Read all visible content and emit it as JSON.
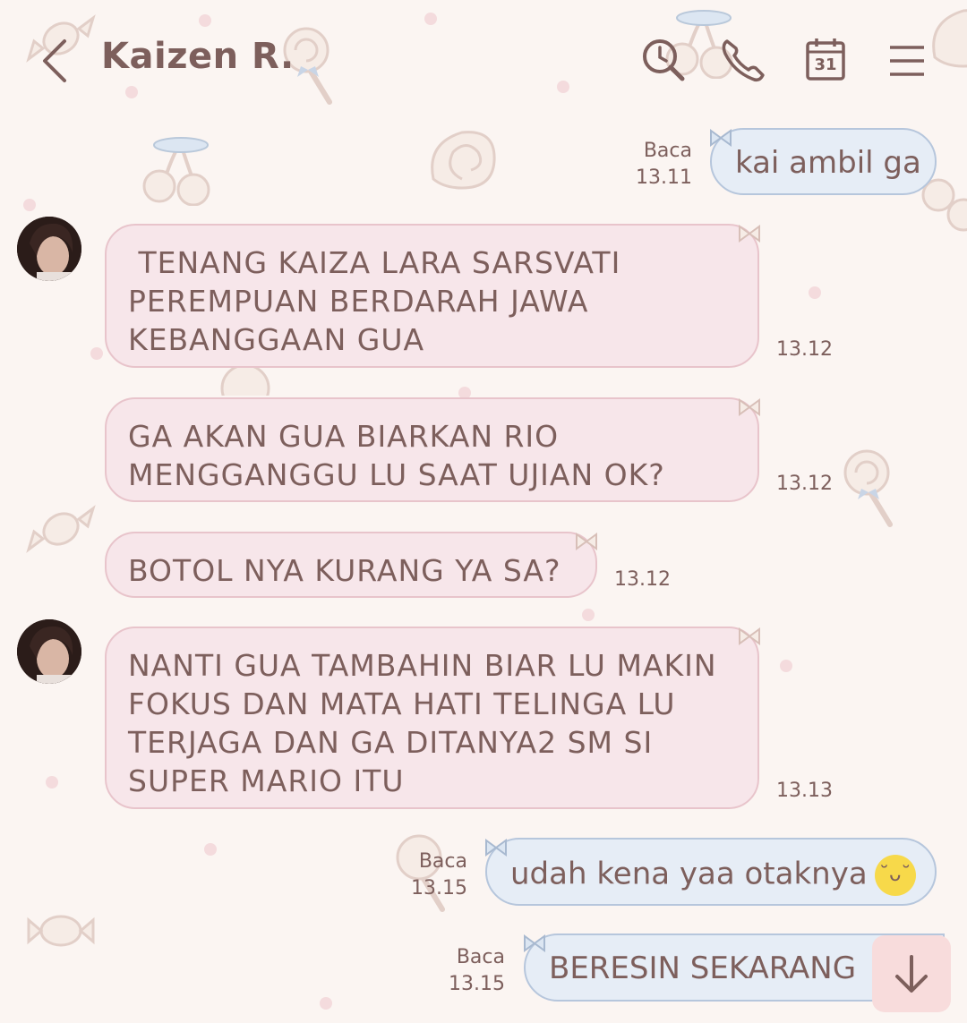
{
  "header": {
    "title": "Kaizen R.",
    "calendar_day": "31"
  },
  "messages": [
    {
      "side": "out",
      "text": "kai ambil ga",
      "read": "Baca",
      "time": "13.11"
    },
    {
      "side": "in",
      "lines": [
        " TENANG KAIZA LARA SARSVATI",
        "PEREMPUAN BERDARAH JAWA",
        "KEBANGGAAN GUA"
      ],
      "time": "13.12"
    },
    {
      "side": "in",
      "lines": [
        "GA AKAN GUA BIARKAN RIO",
        "MENGGANGGU LU SAAT UJIAN OK?"
      ],
      "time": "13.12"
    },
    {
      "side": "in",
      "lines": [
        "BOTOL NYA KURANG YA SA?"
      ],
      "time": "13.12"
    },
    {
      "side": "in",
      "lines": [
        "NANTI GUA TAMBAHIN BIAR LU MAKIN",
        "FOKUS DAN MATA HATI TELINGA LU",
        "TERJAGA DAN GA DITANYA2 SM SI",
        "SUPER MARIO ITU"
      ],
      "time": "13.13"
    },
    {
      "side": "out",
      "text": "udah kena yaa otaknya",
      "read": "Baca",
      "time": "13.15"
    },
    {
      "side": "out",
      "text": "BERESIN SEKARANG",
      "read": "Baca",
      "time": "13.15"
    }
  ],
  "icons": [
    "back-icon",
    "search-clock-icon",
    "phone-icon",
    "calendar-icon",
    "menu-icon",
    "arrow-down-icon"
  ],
  "colors": {
    "background": "#fbf5f2",
    "incoming": "#f7e6ea",
    "outgoing": "#e6edf6",
    "text": "#7d5f5c"
  }
}
